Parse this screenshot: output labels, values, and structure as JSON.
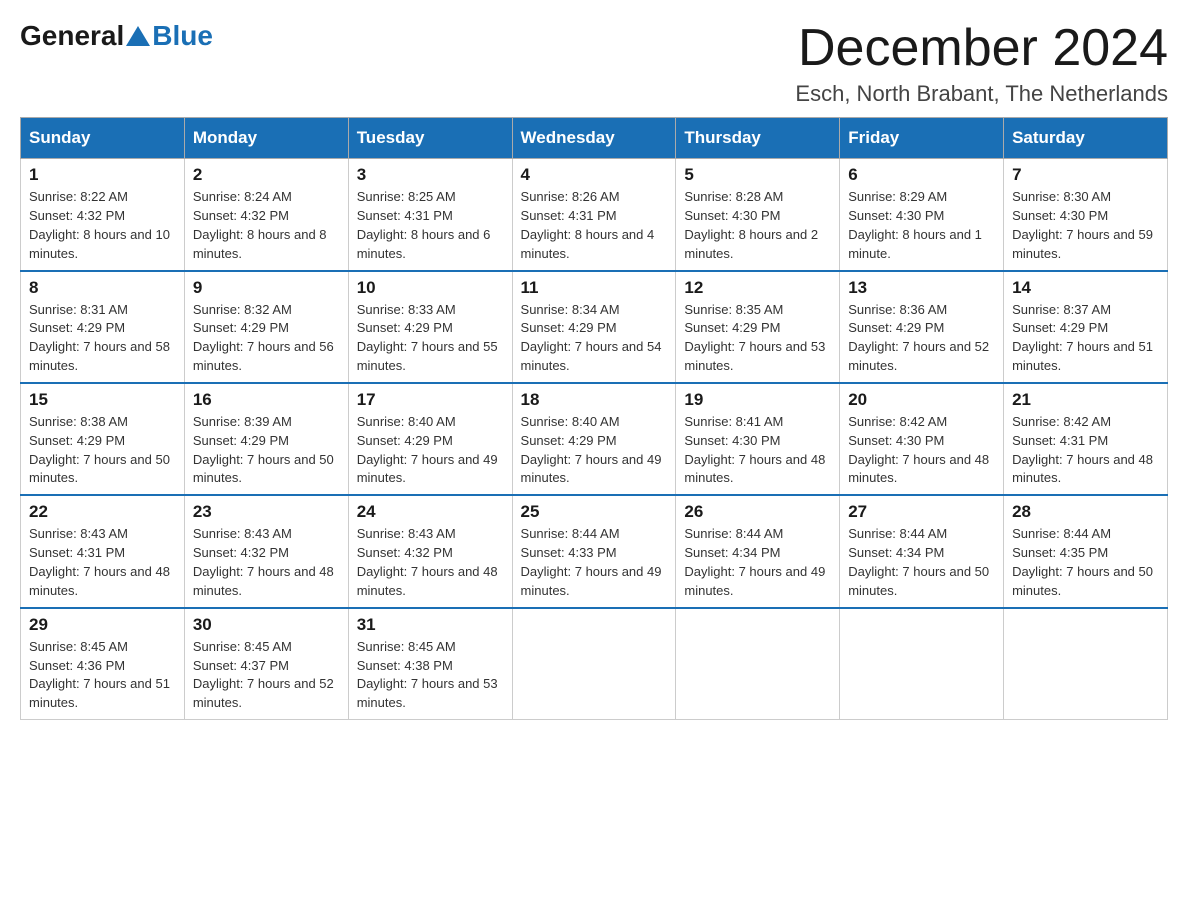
{
  "logo": {
    "general": "General",
    "blue": "Blue"
  },
  "title": "December 2024",
  "subtitle": "Esch, North Brabant, The Netherlands",
  "days_of_week": [
    "Sunday",
    "Monday",
    "Tuesday",
    "Wednesday",
    "Thursday",
    "Friday",
    "Saturday"
  ],
  "weeks": [
    [
      {
        "day": "1",
        "sunrise": "8:22 AM",
        "sunset": "4:32 PM",
        "daylight": "8 hours and 10 minutes."
      },
      {
        "day": "2",
        "sunrise": "8:24 AM",
        "sunset": "4:32 PM",
        "daylight": "8 hours and 8 minutes."
      },
      {
        "day": "3",
        "sunrise": "8:25 AM",
        "sunset": "4:31 PM",
        "daylight": "8 hours and 6 minutes."
      },
      {
        "day": "4",
        "sunrise": "8:26 AM",
        "sunset": "4:31 PM",
        "daylight": "8 hours and 4 minutes."
      },
      {
        "day": "5",
        "sunrise": "8:28 AM",
        "sunset": "4:30 PM",
        "daylight": "8 hours and 2 minutes."
      },
      {
        "day": "6",
        "sunrise": "8:29 AM",
        "sunset": "4:30 PM",
        "daylight": "8 hours and 1 minute."
      },
      {
        "day": "7",
        "sunrise": "8:30 AM",
        "sunset": "4:30 PM",
        "daylight": "7 hours and 59 minutes."
      }
    ],
    [
      {
        "day": "8",
        "sunrise": "8:31 AM",
        "sunset": "4:29 PM",
        "daylight": "7 hours and 58 minutes."
      },
      {
        "day": "9",
        "sunrise": "8:32 AM",
        "sunset": "4:29 PM",
        "daylight": "7 hours and 56 minutes."
      },
      {
        "day": "10",
        "sunrise": "8:33 AM",
        "sunset": "4:29 PM",
        "daylight": "7 hours and 55 minutes."
      },
      {
        "day": "11",
        "sunrise": "8:34 AM",
        "sunset": "4:29 PM",
        "daylight": "7 hours and 54 minutes."
      },
      {
        "day": "12",
        "sunrise": "8:35 AM",
        "sunset": "4:29 PM",
        "daylight": "7 hours and 53 minutes."
      },
      {
        "day": "13",
        "sunrise": "8:36 AM",
        "sunset": "4:29 PM",
        "daylight": "7 hours and 52 minutes."
      },
      {
        "day": "14",
        "sunrise": "8:37 AM",
        "sunset": "4:29 PM",
        "daylight": "7 hours and 51 minutes."
      }
    ],
    [
      {
        "day": "15",
        "sunrise": "8:38 AM",
        "sunset": "4:29 PM",
        "daylight": "7 hours and 50 minutes."
      },
      {
        "day": "16",
        "sunrise": "8:39 AM",
        "sunset": "4:29 PM",
        "daylight": "7 hours and 50 minutes."
      },
      {
        "day": "17",
        "sunrise": "8:40 AM",
        "sunset": "4:29 PM",
        "daylight": "7 hours and 49 minutes."
      },
      {
        "day": "18",
        "sunrise": "8:40 AM",
        "sunset": "4:29 PM",
        "daylight": "7 hours and 49 minutes."
      },
      {
        "day": "19",
        "sunrise": "8:41 AM",
        "sunset": "4:30 PM",
        "daylight": "7 hours and 48 minutes."
      },
      {
        "day": "20",
        "sunrise": "8:42 AM",
        "sunset": "4:30 PM",
        "daylight": "7 hours and 48 minutes."
      },
      {
        "day": "21",
        "sunrise": "8:42 AM",
        "sunset": "4:31 PM",
        "daylight": "7 hours and 48 minutes."
      }
    ],
    [
      {
        "day": "22",
        "sunrise": "8:43 AM",
        "sunset": "4:31 PM",
        "daylight": "7 hours and 48 minutes."
      },
      {
        "day": "23",
        "sunrise": "8:43 AM",
        "sunset": "4:32 PM",
        "daylight": "7 hours and 48 minutes."
      },
      {
        "day": "24",
        "sunrise": "8:43 AM",
        "sunset": "4:32 PM",
        "daylight": "7 hours and 48 minutes."
      },
      {
        "day": "25",
        "sunrise": "8:44 AM",
        "sunset": "4:33 PM",
        "daylight": "7 hours and 49 minutes."
      },
      {
        "day": "26",
        "sunrise": "8:44 AM",
        "sunset": "4:34 PM",
        "daylight": "7 hours and 49 minutes."
      },
      {
        "day": "27",
        "sunrise": "8:44 AM",
        "sunset": "4:34 PM",
        "daylight": "7 hours and 50 minutes."
      },
      {
        "day": "28",
        "sunrise": "8:44 AM",
        "sunset": "4:35 PM",
        "daylight": "7 hours and 50 minutes."
      }
    ],
    [
      {
        "day": "29",
        "sunrise": "8:45 AM",
        "sunset": "4:36 PM",
        "daylight": "7 hours and 51 minutes."
      },
      {
        "day": "30",
        "sunrise": "8:45 AM",
        "sunset": "4:37 PM",
        "daylight": "7 hours and 52 minutes."
      },
      {
        "day": "31",
        "sunrise": "8:45 AM",
        "sunset": "4:38 PM",
        "daylight": "7 hours and 53 minutes."
      },
      null,
      null,
      null,
      null
    ]
  ]
}
